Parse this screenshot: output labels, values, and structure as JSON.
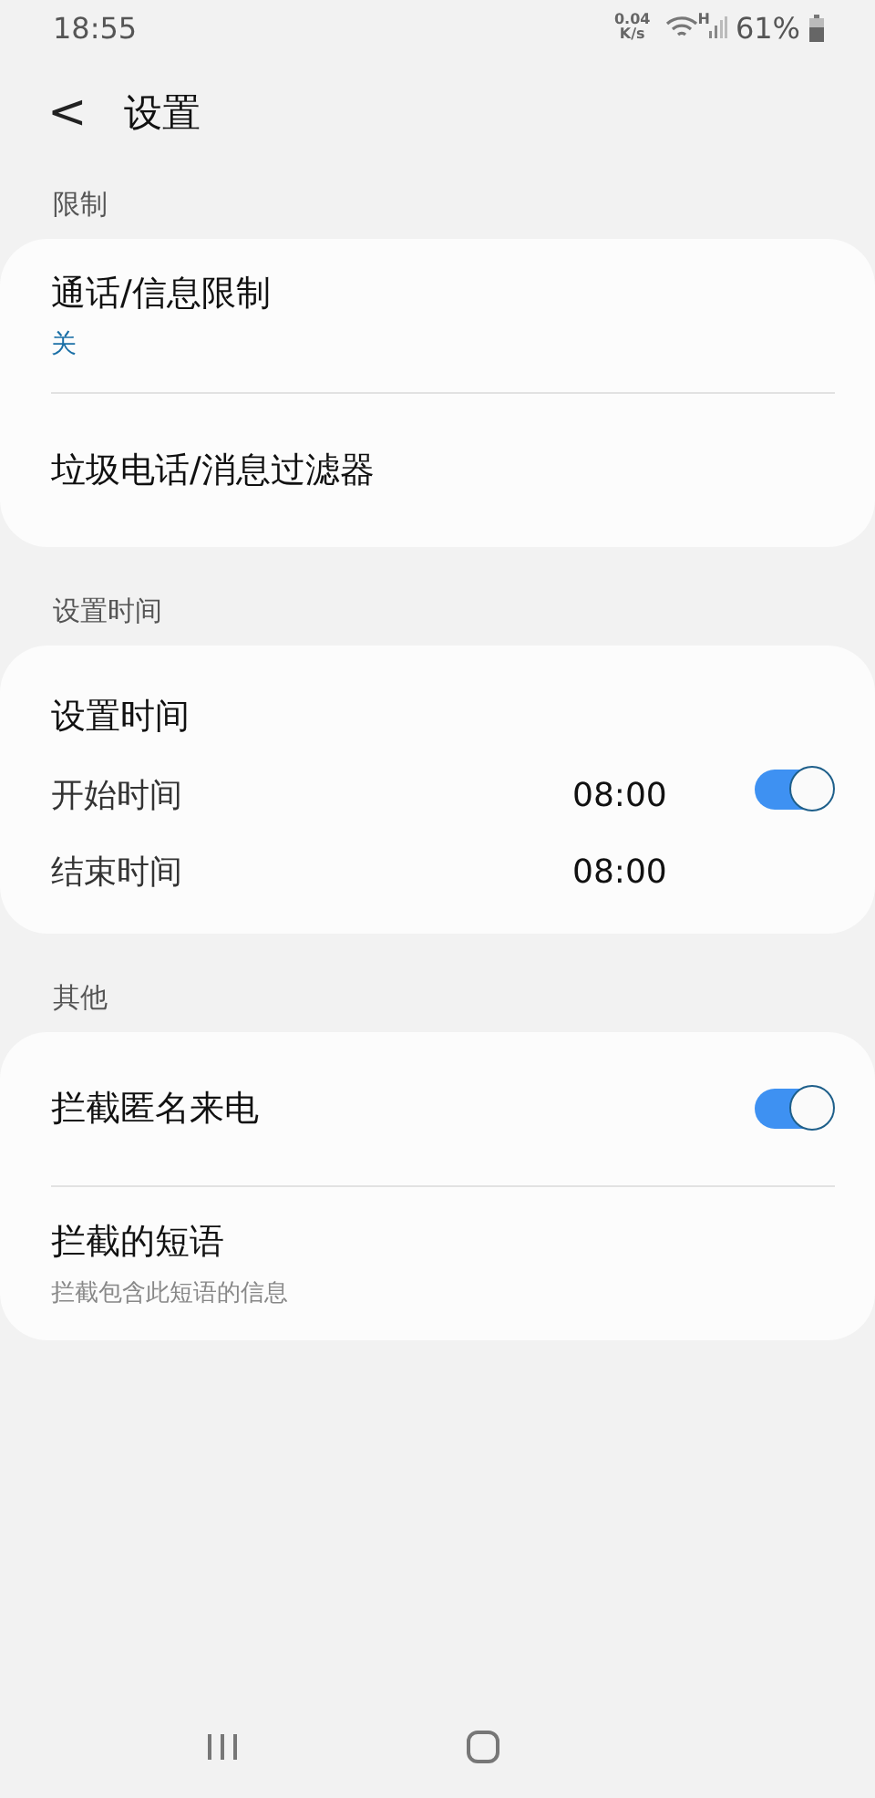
{
  "status_bar": {
    "time": "18:55",
    "speed_value": "0.04",
    "speed_unit": "K/s",
    "network_type": "H",
    "battery": "61%"
  },
  "header": {
    "back": "<",
    "title": "设置"
  },
  "sections": [
    {
      "label": "限制",
      "items": [
        {
          "kind": "link",
          "title": "通话/信息限制",
          "subtitle": "关",
          "subtitle_accent": true
        },
        {
          "kind": "link",
          "title": "垃圾电话/消息过滤器"
        }
      ]
    },
    {
      "label": "设置时间",
      "items": [
        {
          "kind": "schedule",
          "title": "设置时间",
          "on": true,
          "rows": [
            {
              "label": "开始时间",
              "value": "08:00"
            },
            {
              "label": "结束时间",
              "value": "08:00"
            }
          ]
        }
      ]
    },
    {
      "label": "其他",
      "items": [
        {
          "kind": "switch",
          "title": "拦截匿名来电",
          "on": true
        },
        {
          "kind": "link",
          "title": "拦截的短语",
          "subtitle": "拦截包含此短语的信息",
          "subtitle_accent": false
        }
      ]
    }
  ]
}
